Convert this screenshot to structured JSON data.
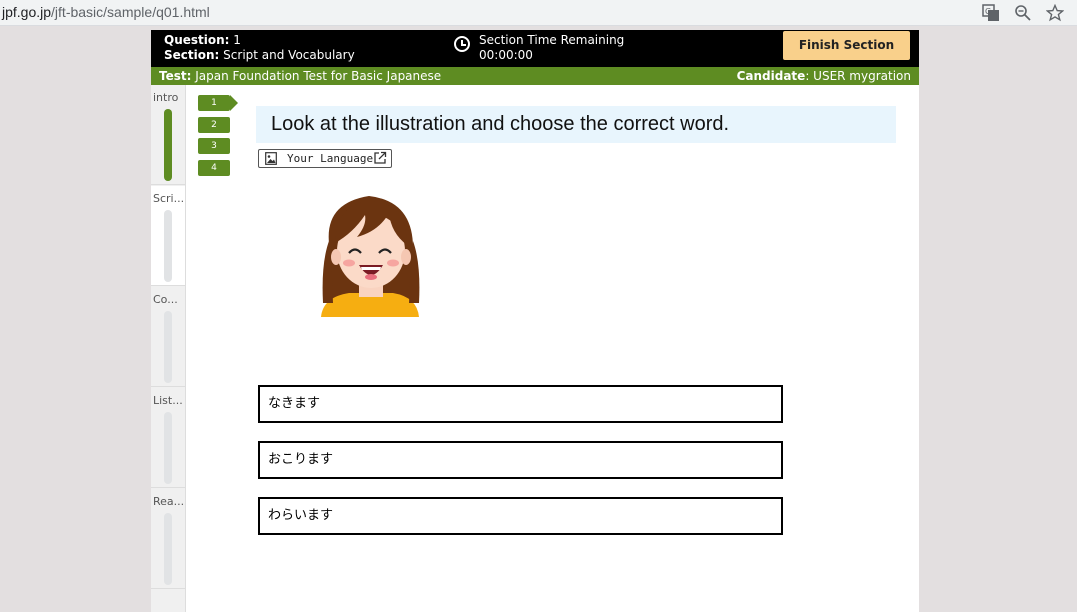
{
  "browser": {
    "url_host": "jpf.go.jp",
    "url_path": "/jft-basic/sample/q01.html",
    "icons": [
      "translate-icon",
      "zoom-icon",
      "star-icon"
    ]
  },
  "header": {
    "question_label": "Question:",
    "question_value": "1",
    "section_label": "Section:",
    "section_value": "Script and Vocabulary",
    "timer_label": "Section Time Remaining",
    "timer_value": "00:00:00",
    "finish_button": "Finish Section"
  },
  "subheader": {
    "test_label": "Test:",
    "test_value": "Japan Foundation Test for Basic Japanese",
    "candidate_label": "Candidate",
    "candidate_value": ": USER mygration"
  },
  "sections": [
    {
      "label": "intro",
      "progress": 1.0,
      "active": false
    },
    {
      "label": "Scri...",
      "progress": 0,
      "active": true
    },
    {
      "label": "Co...",
      "progress": 0,
      "active": false
    },
    {
      "label": "List...",
      "progress": 0,
      "active": false
    },
    {
      "label": "Rea...",
      "progress": 0,
      "active": false
    }
  ],
  "question_tabs": [
    "1",
    "2",
    "3",
    "4"
  ],
  "current_question": "1",
  "main": {
    "instruction": "Look at the illustration and choose the correct word.",
    "language_button": "Your Language",
    "choices": [
      "なきます",
      "おこります",
      "わらいます"
    ]
  },
  "colors": {
    "accent_green": "#5e8c22",
    "finish_button_bg": "#f9d08b",
    "instruction_bg": "#e8f5fd"
  }
}
